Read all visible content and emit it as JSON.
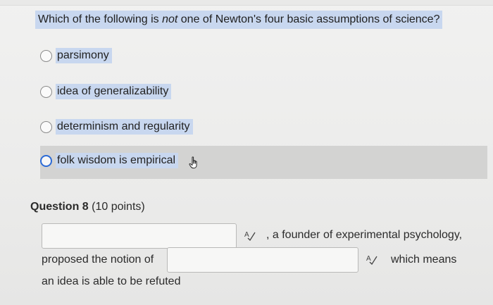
{
  "question": {
    "prefix": "Which of the following is ",
    "emphasis": "not",
    "suffix": " one of Newton's four basic assumptions of science?"
  },
  "options": [
    {
      "label": "parsimony",
      "selected": false
    },
    {
      "label": "idea of generalizability",
      "selected": false
    },
    {
      "label": "determinism and regularity",
      "selected": false
    },
    {
      "label": "folk wisdom is empirical",
      "selected": false,
      "hovered": true
    }
  ],
  "question8": {
    "title": "Question 8",
    "points": " (10 points)",
    "blank1_value": "",
    "blank2_value": "",
    "text_after_blank1": ", a founder of experimental psychology,",
    "text_before_blank2": "proposed the notion of",
    "text_after_blank2": "which means",
    "text_last_line": "an idea is able to be refuted"
  },
  "icons": {
    "cursor": "hand-pointer-icon",
    "spellcheck": "spellcheck-icon"
  },
  "colors": {
    "selection_highlight": "#c8d7ef",
    "hover_row": "#d3d3d2",
    "focus_ring": "#2c6bd6"
  }
}
